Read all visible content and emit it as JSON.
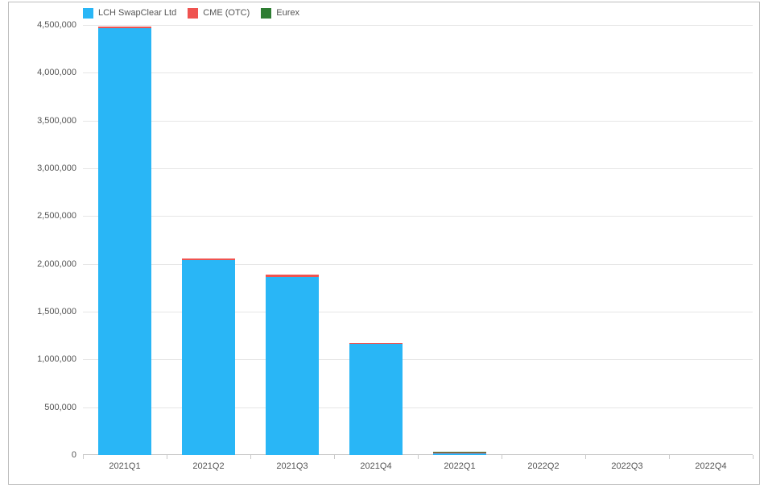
{
  "chart_data": {
    "type": "bar",
    "stacked": true,
    "categories": [
      "2021Q1",
      "2021Q2",
      "2021Q3",
      "2021Q4",
      "2022Q1",
      "2022Q2",
      "2022Q3",
      "2022Q4"
    ],
    "series": [
      {
        "name": "LCH SwapClear Ltd",
        "color": "#29b6f6",
        "values": [
          4470000,
          2040000,
          1860000,
          1160000,
          20000,
          0,
          0,
          0
        ]
      },
      {
        "name": "CME (OTC)",
        "color": "#ef5350",
        "values": [
          15000,
          15000,
          25000,
          10000,
          5000,
          0,
          0,
          0
        ]
      },
      {
        "name": "Eurex",
        "color": "#2e7d32",
        "values": [
          0,
          0,
          0,
          0,
          5000,
          0,
          0,
          0
        ]
      }
    ],
    "title": "",
    "xlabel": "",
    "ylabel": "",
    "ylim": [
      0,
      4500000
    ],
    "yticks": [
      0,
      500000,
      1000000,
      1500000,
      2000000,
      2500000,
      3000000,
      3500000,
      4000000,
      4500000
    ]
  },
  "legend": {
    "series0": "LCH SwapClear Ltd",
    "series1": "CME (OTC)",
    "series2": "Eurex"
  },
  "colors": {
    "series0": "#29b6f6",
    "series1": "#ef5350",
    "series2": "#2e7d32"
  },
  "ylabels": {
    "t0": "0",
    "t1": "500,000",
    "t2": "1,000,000",
    "t3": "1,500,000",
    "t4": "2,000,000",
    "t5": "2,500,000",
    "t6": "3,000,000",
    "t7": "3,500,000",
    "t8": "4,000,000",
    "t9": "4,500,000"
  },
  "xlabels": {
    "c0": "2021Q1",
    "c1": "2021Q2",
    "c2": "2021Q3",
    "c3": "2021Q4",
    "c4": "2022Q1",
    "c5": "2022Q2",
    "c6": "2022Q3",
    "c7": "2022Q4"
  }
}
